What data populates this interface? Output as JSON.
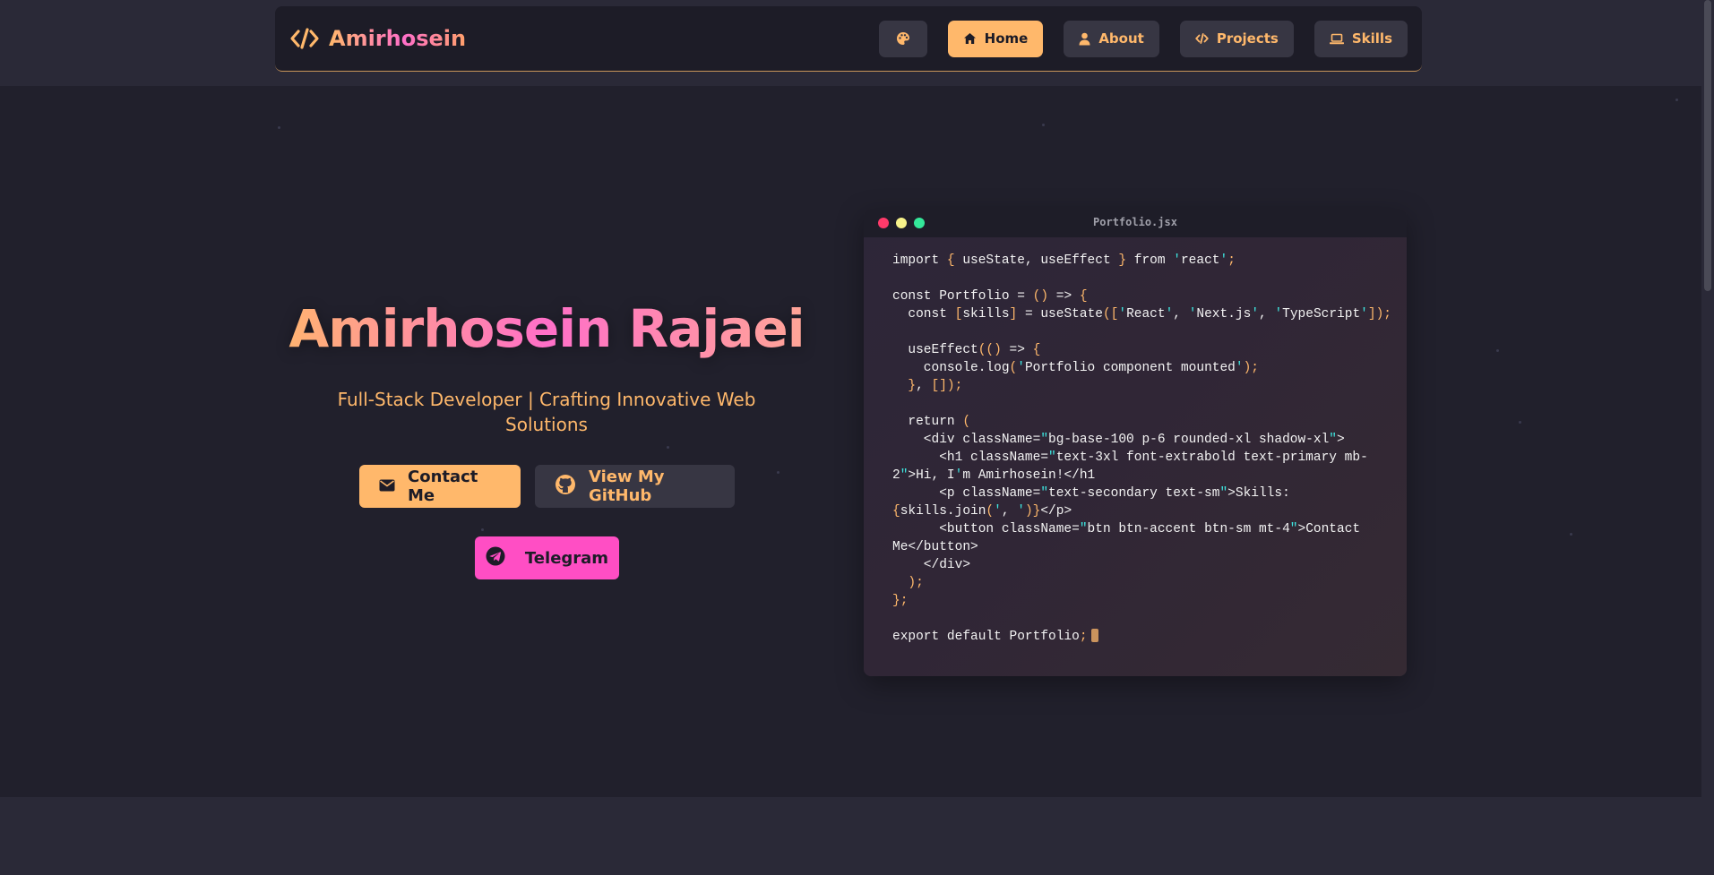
{
  "navbar": {
    "brand": "Amirhosein",
    "theme_icon": "palette-icon",
    "items": [
      {
        "label": "Home",
        "icon": "home-icon",
        "active": true
      },
      {
        "label": "About",
        "icon": "user-icon",
        "active": false
      },
      {
        "label": "Projects",
        "icon": "code-icon",
        "active": false
      },
      {
        "label": "Skills",
        "icon": "laptop-icon",
        "active": false
      }
    ]
  },
  "hero": {
    "title": "Amirhosein Rajaei",
    "subtitle": "Full-Stack Developer | Crafting Innovative Web Solutions",
    "buttons": {
      "contact": "Contact Me",
      "github": "View My GitHub",
      "telegram": "Telegram"
    }
  },
  "code_window": {
    "filename": "Portfolio.jsx",
    "lines": [
      "import { useState, useEffect } from 'react';",
      "",
      "const Portfolio = () => {",
      "  const [skills] = useState(['React', 'Next.js', 'TypeScript']);",
      "",
      "  useEffect(() => {",
      "    console.log('Portfolio component mounted');",
      "  }, []);",
      "",
      "  return (",
      "    <div className=\"bg-base-100 p-6 rounded-xl shadow-xl\">",
      "      <h1 className=\"text-3xl font-extrabold text-primary mb-",
      "2\">Hi, I'm Amirhosein!</h1>",
      "      <p className=\"text-secondary text-sm\">Skills:",
      "{skills.join(', ')}</p>",
      "      <button className=\"btn btn-accent btn-sm mt-4\">Contact",
      "Me</button>",
      "    </div>",
      "  );",
      "};",
      "",
      "export default Portfolio;"
    ]
  },
  "colors": {
    "accent": "#ffb86b",
    "pink": "#ff4ec4",
    "background": "#21202c"
  }
}
